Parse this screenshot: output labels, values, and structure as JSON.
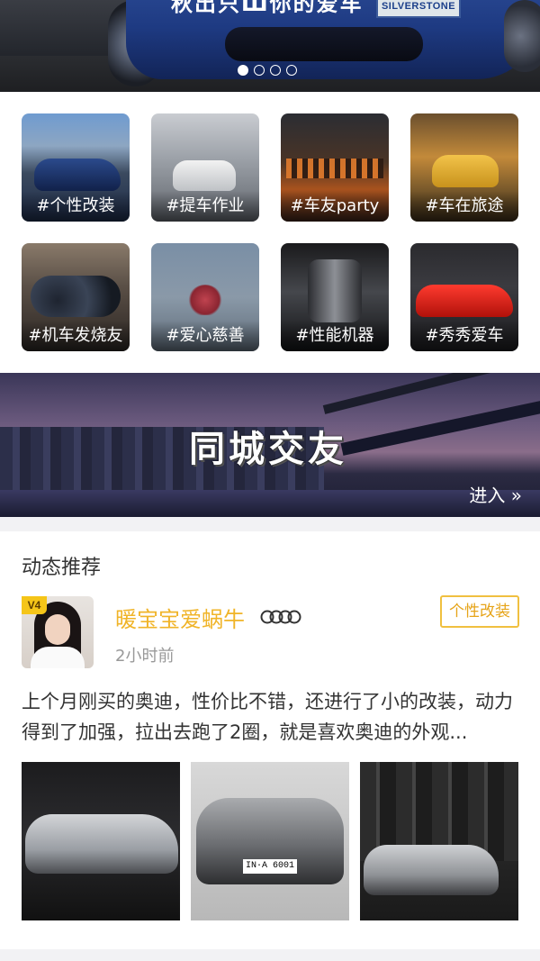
{
  "banner": {
    "caption": "秋出只Ш你的爱车",
    "plate_text": "SILVERSTONE",
    "dots_count": 4,
    "active_dot": 0
  },
  "categories": [
    {
      "label": "#个性改装"
    },
    {
      "label": "#提车作业"
    },
    {
      "label": "#车友party"
    },
    {
      "label": "#车在旅途"
    },
    {
      "label": "#机车发烧友"
    },
    {
      "label": "#爱心慈善"
    },
    {
      "label": "#性能机器"
    },
    {
      "label": "#秀秀爱车"
    }
  ],
  "city_banner": {
    "title": "同城交友",
    "enter_label": "进入 »"
  },
  "feed": {
    "section_title": "动态推荐",
    "post": {
      "level_badge": "V4",
      "username": "暖宝宝爱蜗牛",
      "brand_icon": "audi-rings-icon",
      "time": "2小时前",
      "tag": "个性改装",
      "text": "上个月刚买的奥迪，性价比不错，还进行了小的改装，动力得到了加强，拉出去跑了2圈，就是喜欢奥迪的外观...",
      "photo_plate": "IN·A 6001"
    }
  },
  "colors": {
    "accent": "#f0b428",
    "tag_border": "#f0c040",
    "muted_text": "#999999",
    "divider": "#f2f2f4"
  }
}
